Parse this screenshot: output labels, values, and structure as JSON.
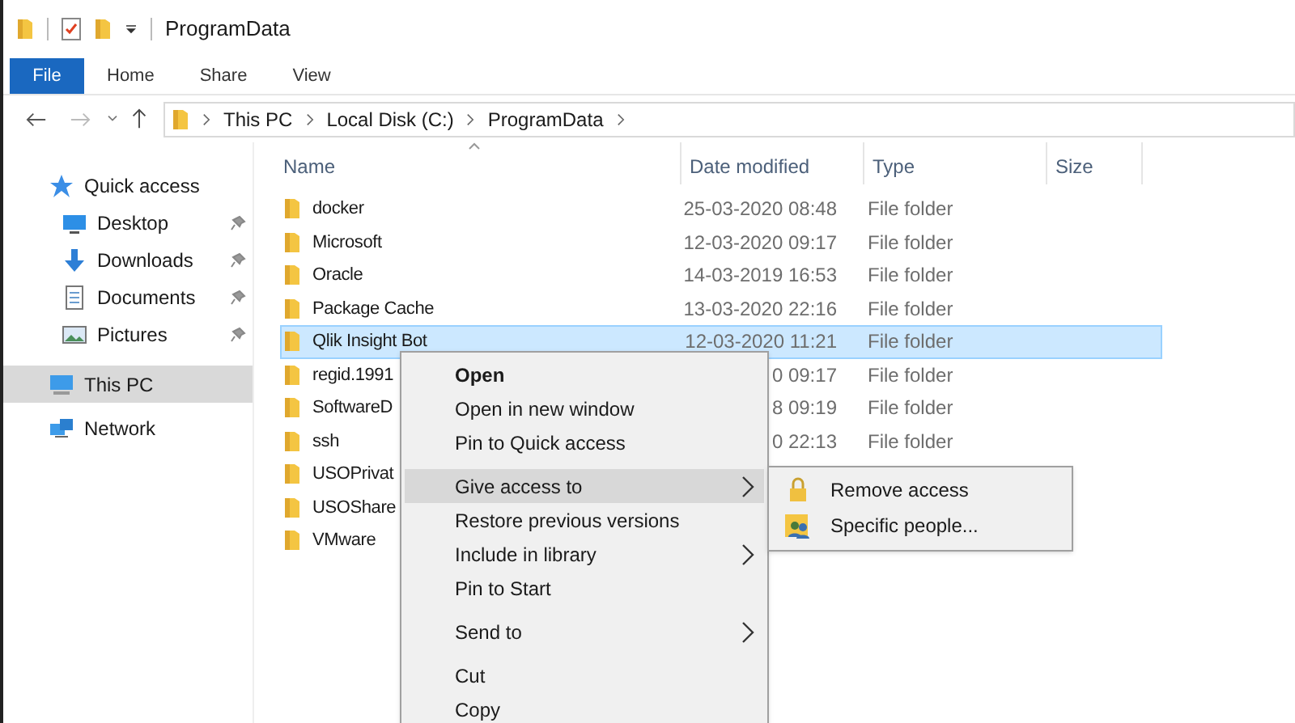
{
  "window": {
    "title": "ProgramData"
  },
  "ribbon_tabs": [
    {
      "label": "File",
      "selected": true
    },
    {
      "label": "Home",
      "selected": false
    },
    {
      "label": "Share",
      "selected": false
    },
    {
      "label": "View",
      "selected": false
    }
  ],
  "breadcrumb": [
    "This PC",
    "Local Disk (C:)",
    "ProgramData"
  ],
  "sidebar": {
    "items": [
      {
        "label": "Quick access",
        "kind": "star",
        "pinned": false,
        "selected": false
      },
      {
        "label": "Desktop",
        "kind": "desktop",
        "pinned": true,
        "selected": false
      },
      {
        "label": "Downloads",
        "kind": "download",
        "pinned": true,
        "selected": false
      },
      {
        "label": "Documents",
        "kind": "document",
        "pinned": true,
        "selected": false
      },
      {
        "label": "Pictures",
        "kind": "pictures",
        "pinned": true,
        "selected": false
      },
      {
        "label": "This PC",
        "kind": "pc",
        "pinned": false,
        "selected": true
      },
      {
        "label": "Network",
        "kind": "network",
        "pinned": false,
        "selected": false
      }
    ]
  },
  "table": {
    "columns": [
      "Name",
      "Date modified",
      "Type",
      "Size"
    ],
    "rows": [
      {
        "name": "docker",
        "date": "25-03-2020 08:48",
        "type": "File folder",
        "selected": false
      },
      {
        "name": "Microsoft",
        "date": "12-03-2020 09:17",
        "type": "File folder",
        "selected": false
      },
      {
        "name": "Oracle",
        "date": "14-03-2019 16:53",
        "type": "File folder",
        "selected": false
      },
      {
        "name": "Package Cache",
        "date": "13-03-2020 22:16",
        "type": "File folder",
        "selected": false
      },
      {
        "name": "Qlik Insight Bot",
        "date": "12-03-2020 11:21",
        "type": "File folder",
        "selected": true
      },
      {
        "name": "regid.1991",
        "date": "0 09:17",
        "type": "File folder",
        "selected": false
      },
      {
        "name": "SoftwareD",
        "date": "8 09:19",
        "type": "File folder",
        "selected": false
      },
      {
        "name": "ssh",
        "date": "0 22:13",
        "type": "File folder",
        "selected": false
      },
      {
        "name": "USOPrivat",
        "selected": false
      },
      {
        "name": "USOShare",
        "selected": false
      },
      {
        "name": "VMware",
        "selected": false
      }
    ]
  },
  "context_menu": {
    "items": [
      {
        "kind": "item",
        "label": "Open",
        "default": true,
        "submenu": false,
        "selected": false
      },
      {
        "kind": "item",
        "label": "Open in new window",
        "default": false,
        "submenu": false,
        "selected": false
      },
      {
        "kind": "item",
        "label": "Pin to Quick access",
        "default": false,
        "submenu": false,
        "selected": false
      },
      {
        "kind": "separator"
      },
      {
        "kind": "item",
        "label": "Give access to",
        "default": false,
        "submenu": true,
        "selected": true
      },
      {
        "kind": "item",
        "label": "Restore previous versions",
        "default": false,
        "submenu": false,
        "selected": false
      },
      {
        "kind": "item",
        "label": "Include in library",
        "default": false,
        "submenu": true,
        "selected": false
      },
      {
        "kind": "item",
        "label": "Pin to Start",
        "default": false,
        "submenu": false,
        "selected": false
      },
      {
        "kind": "separator"
      },
      {
        "kind": "item",
        "label": "Send to",
        "default": false,
        "submenu": true,
        "selected": false
      },
      {
        "kind": "separator"
      },
      {
        "kind": "item",
        "label": "Cut",
        "default": false,
        "submenu": false,
        "selected": false
      },
      {
        "kind": "item",
        "label": "Copy",
        "default": false,
        "submenu": false,
        "selected": false
      }
    ]
  },
  "submenu": {
    "items": [
      {
        "label": "Remove access",
        "kind": "lock"
      },
      {
        "label": "Specific people...",
        "kind": "people"
      }
    ]
  }
}
